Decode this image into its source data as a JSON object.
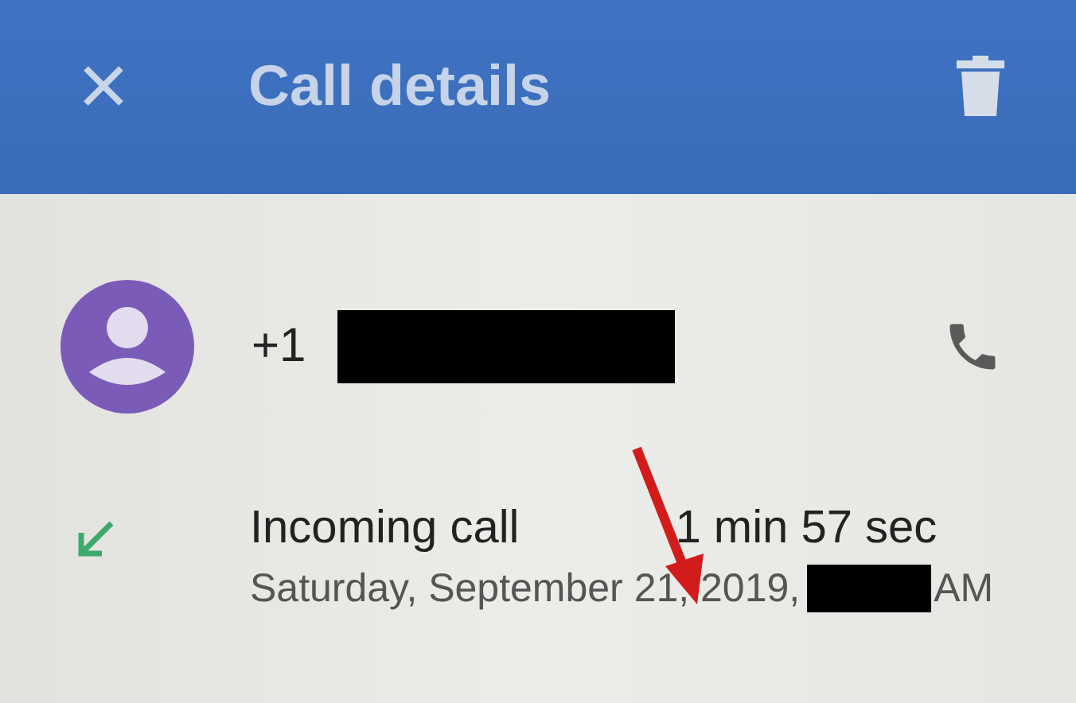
{
  "header": {
    "title": "Call details"
  },
  "contact": {
    "number_prefix": "+1"
  },
  "call": {
    "type": "Incoming call",
    "duration": "1 min 57 sec",
    "date": "Saturday, September 21, 2019,",
    "time_suffix": "AM"
  }
}
